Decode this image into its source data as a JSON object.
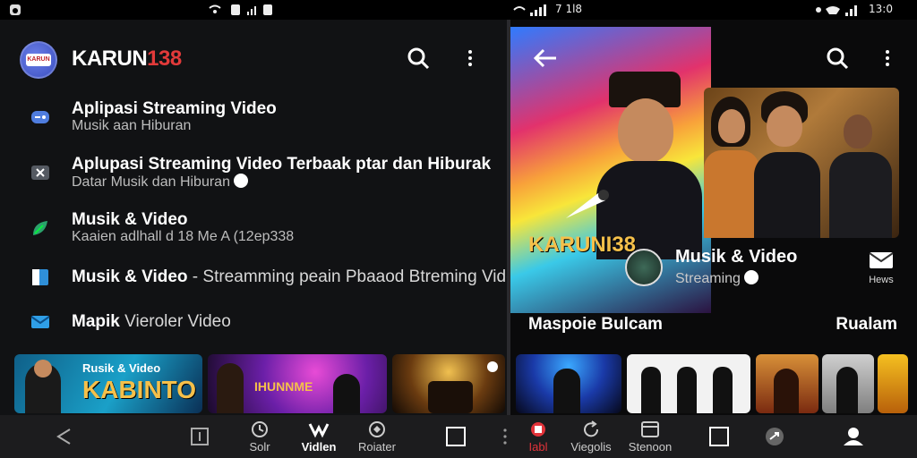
{
  "status_bar": {
    "time_left": "7 1l8",
    "time_right": "13:0"
  },
  "left_panel": {
    "brand_name": "KARUN",
    "brand_number": "138",
    "logo_label": "KARUN",
    "list": [
      {
        "title": "Aplipasi Streaming Video",
        "subtitle": "Musik aan Hiburan",
        "icon": "game-controller-icon",
        "color": "#4f7ddf"
      },
      {
        "title": "Aplupasi Streaming Video Terbaak ptar dan Hiburak",
        "subtitle": "Datar Musik dan Hiburan",
        "icon": "video-cut-icon",
        "color": "#555a62"
      },
      {
        "title": "Musik & Video",
        "subtitle": "Kaaien adlhall d 18 Me A (12ep338",
        "icon": "leaf-icon",
        "color": "#2aa36b"
      },
      {
        "title": "Musik & Video",
        "title_suffix": " - Streamming peain Pbaaod Btreming Video",
        "icon": "book-icon",
        "color": "#2f8fd8"
      },
      {
        "title": "Mapik",
        "title_suffix": " Vieroler Video",
        "icon": "mail-icon",
        "color": "#2f9fe8"
      }
    ],
    "thumbs": [
      {
        "line1": "Rusik & Video",
        "line2": "KABINTO"
      },
      {
        "line1": "IHUNNME"
      }
    ]
  },
  "right_panel": {
    "hero_title": "KARUNI38",
    "channel": {
      "title": "Musik & Video",
      "subtitle": "Streaming"
    },
    "mail_label": "Hews",
    "section_left": "Maspoie Bulcam",
    "section_right": "Rualam"
  },
  "nav": {
    "items": [
      {
        "label": "Solr",
        "icon": "clock-icon"
      },
      {
        "label": "Vidlen",
        "icon": "video-icon",
        "active": true
      },
      {
        "label": "Roiater",
        "icon": "settings-icon"
      },
      {
        "label": "Iabl",
        "icon": "record-icon"
      },
      {
        "label": "Viegolis",
        "icon": "refresh-icon"
      },
      {
        "label": "Stenoon",
        "icon": "film-icon"
      }
    ]
  }
}
